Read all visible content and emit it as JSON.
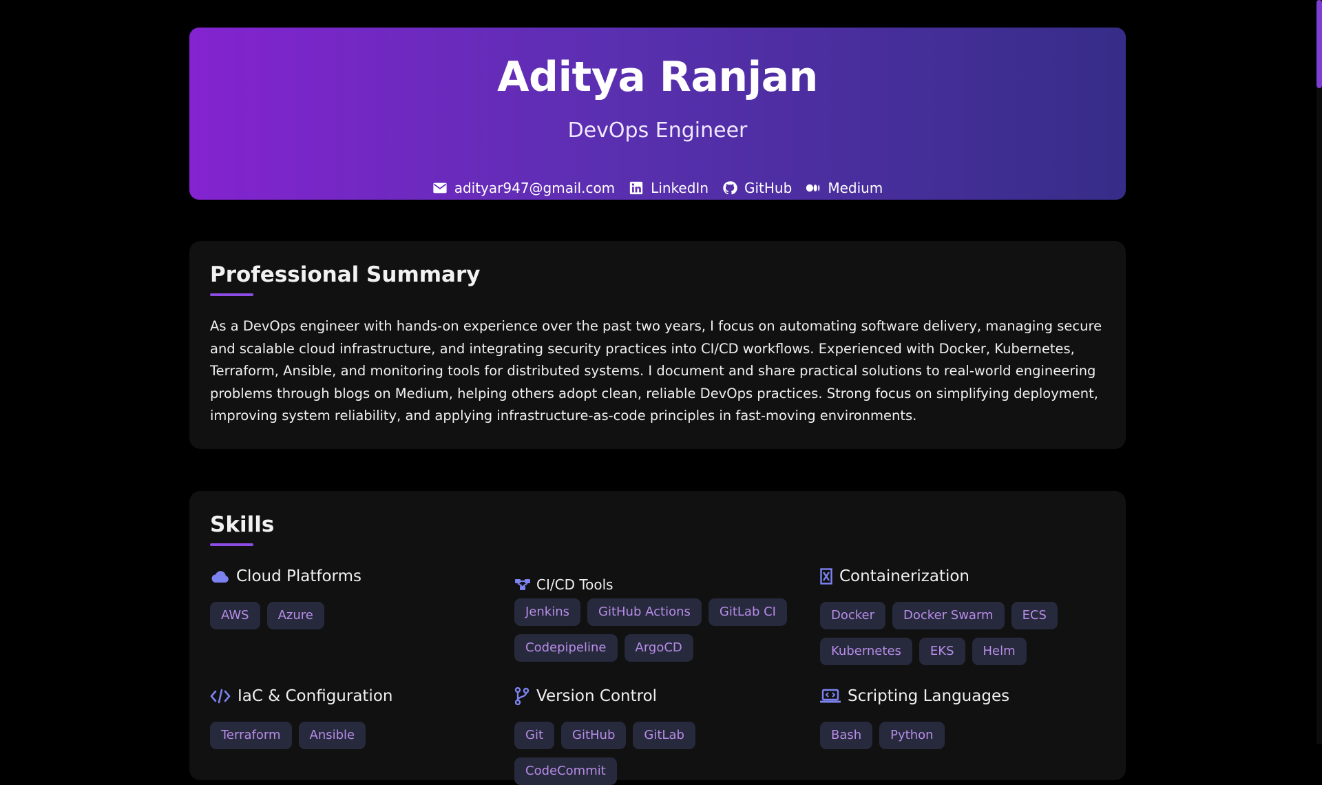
{
  "header": {
    "name": "Aditya Ranjan",
    "title": "DevOps Engineer",
    "contacts": [
      {
        "icon": "envelope-icon",
        "label": "adityar947@gmail.com"
      },
      {
        "icon": "linkedin-icon",
        "label": "LinkedIn"
      },
      {
        "icon": "github-icon",
        "label": "GitHub"
      },
      {
        "icon": "medium-icon",
        "label": "Medium"
      }
    ]
  },
  "summary": {
    "heading": "Professional Summary",
    "text": "As a DevOps engineer with hands-on experience over the past two years, I focus on automating software delivery, managing secure and scalable cloud infrastructure, and integrating security practices into CI/CD workflows. Experienced with Docker, Kubernetes, Terraform, Ansible, and monitoring tools for distributed systems. I document and share practical solutions to real-world engineering problems through blogs on Medium, helping others adopt clean, reliable DevOps practices. Strong focus on simplifying deployment, improving system reliability, and applying infrastructure-as-code principles in fast-moving environments."
  },
  "skills": {
    "heading": "Skills",
    "groups": [
      {
        "title": "Cloud Platforms",
        "icon": "cloud-icon",
        "tags": [
          "AWS",
          "Azure"
        ]
      },
      {
        "title": "CI/CD Tools",
        "icon": "pipeline-icon",
        "tags": [
          "Jenkins",
          "GitHub Actions",
          "GitLab CI",
          "Codepipeline",
          "ArgoCD"
        ]
      },
      {
        "title": "Containerization",
        "icon": "container-icon",
        "tags": [
          "Docker",
          "Docker Swarm",
          "ECS",
          "Kubernetes",
          "EKS",
          "Helm"
        ]
      },
      {
        "title": "IaC & Configuration",
        "icon": "code-icon",
        "tags": [
          "Terraform",
          "Ansible"
        ]
      },
      {
        "title": "Version Control",
        "icon": "branch-icon",
        "tags": [
          "Git",
          "GitHub",
          "GitLab",
          "CodeCommit"
        ]
      },
      {
        "title": "Scripting Languages",
        "icon": "laptop-code-icon",
        "tags": [
          "Bash",
          "Python"
        ]
      }
    ]
  },
  "colors": {
    "accent": "#8d4de4",
    "header_gradient_start": "#8423d0",
    "header_gradient_end": "#362d88",
    "tag_background": "#262a3c",
    "tag_text": "#b88ce8",
    "icon_color": "#7c83f0",
    "card_background": "#111111",
    "page_background": "#000000"
  }
}
